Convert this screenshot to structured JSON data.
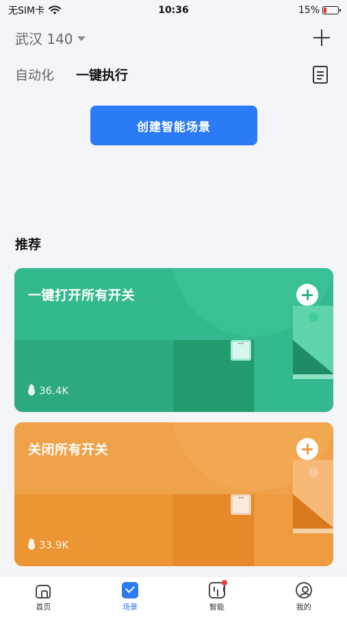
{
  "status_bar": {
    "carrier": "无SIM卡",
    "time": "10:36",
    "battery": "15%"
  },
  "header": {
    "home_name": "武汉 140"
  },
  "tabs": [
    {
      "label": "自动化",
      "active": false
    },
    {
      "label": "一键执行",
      "active": true
    }
  ],
  "create_button": {
    "label": "创建智能场景"
  },
  "recommend": {
    "title": "推荐",
    "cards": [
      {
        "title": "一键打开所有开关",
        "count": "36.4K",
        "color": "#2eb389"
      },
      {
        "title": "关闭所有开关",
        "count": "33.9K",
        "color": "#ef9a3c"
      }
    ]
  },
  "bottom_nav": [
    {
      "label": "首页",
      "icon": "home-icon",
      "active": false
    },
    {
      "label": "场景",
      "icon": "scene-icon",
      "active": true
    },
    {
      "label": "智能",
      "icon": "smart-icon",
      "active": false
    },
    {
      "label": "我的",
      "icon": "profile-icon",
      "active": false
    }
  ],
  "colors": {
    "accent": "#2b7bf6",
    "background": "#f4f5f9",
    "badge_red": "#f03a3a"
  }
}
